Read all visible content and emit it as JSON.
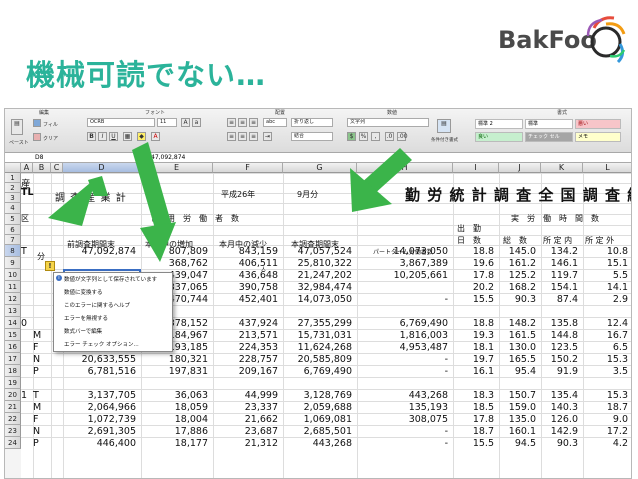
{
  "slide": {
    "title": "機械可読でない…"
  },
  "logo": {
    "text": "BakFoo"
  },
  "ribbon": {
    "groups": [
      "編集",
      "フォント",
      "配置",
      "数値",
      "書式"
    ],
    "fill_label": "フィル",
    "clear_label": "クリア",
    "paste_label": "ペースト",
    "font_name": "OCRB",
    "font_size": "11",
    "wrap_label": "折り返し",
    "abc_label": "abc",
    "merge_label": "結合",
    "number_format": "文字列",
    "cond_format": "条件付き書式",
    "styles": [
      "標準 2",
      "標準",
      "悪い",
      "良い",
      "チェック セル",
      "メモ"
    ]
  },
  "formula_bar": {
    "cell_ref": "D8",
    "value": "47,092,874"
  },
  "columns": [
    "A",
    "B",
    "C",
    "D",
    "E",
    "F",
    "G",
    "H",
    "I",
    "J",
    "K",
    "L"
  ],
  "rows": [
    "1",
    "2",
    "3",
    "4",
    "5",
    "6",
    "7",
    "8",
    "9",
    "10",
    "11",
    "12",
    "13",
    "14",
    "15",
    "16",
    "17",
    "18",
    "19",
    "20",
    "21",
    "22",
    "23",
    "24"
  ],
  "header": {
    "r1_a": "産",
    "r2_a": "TL",
    "r2_c": "調 査 産 業 計",
    "r2_f": "平成26年",
    "r2_g": "9月分",
    "title_big": "勤 労 統 計 調 査 全 国 調 査 結",
    "r4_a": "区",
    "kubun_top": "常　用　労　働　者　数",
    "col_d": "前調査期間末",
    "col_e": "本月中の増加",
    "col_f": "本月中の減少",
    "col_g": "本調査期間末",
    "col_h": "パートタイム労働者数",
    "shukkin": "出　勤",
    "nissu": "日　数",
    "jitsu": "実　労　働　時　間　数",
    "soukei": "総　数",
    "shoteinai": "所 定 内",
    "shoteigai": "所 定 外",
    "r6_a": "分",
    "unit_a": "人"
  },
  "error_menu": {
    "items": [
      "数値が文字列として保存されています",
      "数値に変換する",
      "このエラーに関するヘルプ",
      "エラーを無視する",
      "数式バーで編集",
      "エラー チェック オプション..."
    ]
  },
  "table": [
    {
      "r": "8",
      "a": "T",
      "b": "",
      "d": "47,092,874",
      "e": "807,809",
      "f": "843,159",
      "g": "47,057,524",
      "h": "14,073,050",
      "i": "18.8",
      "j": "145.0",
      "k": "134.2",
      "l": "10.8"
    },
    {
      "r": "9",
      "a": "",
      "b": "",
      "d": "",
      "e": "368,762",
      "f": "406,511",
      "g": "25,810,322",
      "h": "3,867,389",
      "i": "19.6",
      "j": "161.2",
      "k": "146.1",
      "l": "15.1"
    },
    {
      "r": "10",
      "a": "",
      "b": "",
      "d": "",
      "e": "439,047",
      "f": "436,648",
      "g": "21,247,202",
      "h": "10,205,661",
      "i": "17.8",
      "j": "125.2",
      "k": "119.7",
      "l": "5.5"
    },
    {
      "r": "11",
      "a": "",
      "b": "",
      "d": "",
      "e": "337,065",
      "f": "390,758",
      "g": "32,984,474",
      "h": "",
      "i": "20.2",
      "j": "168.2",
      "k": "154.1",
      "l": "14.1"
    },
    {
      "r": "12",
      "a": "",
      "b": "",
      "d": "",
      "e": "470,744",
      "f": "452,401",
      "g": "14,073,050",
      "h": "-",
      "i": "15.5",
      "j": "90.3",
      "k": "87.4",
      "l": "2.9"
    },
    {
      "r": "13",
      "a": "",
      "b": "",
      "d": "",
      "e": "",
      "f": "",
      "g": "",
      "h": "",
      "i": "",
      "j": "",
      "k": "",
      "l": ""
    },
    {
      "r": "14",
      "a": "0",
      "b": "",
      "d": "",
      "e": "378,152",
      "f": "437,924",
      "g": "27,355,299",
      "h": "6,769,490",
      "i": "18.8",
      "j": "148.2",
      "k": "135.8",
      "l": "12.4"
    },
    {
      "r": "15",
      "a": "",
      "b": "M",
      "d": "",
      "e": "184,967",
      "f": "213,571",
      "g": "15,731,031",
      "h": "1,816,003",
      "i": "19.3",
      "j": "161.5",
      "k": "144.8",
      "l": "16.7"
    },
    {
      "r": "16",
      "a": "",
      "b": "F",
      "d": "11,655,436",
      "e": "193,185",
      "f": "224,353",
      "g": "11,624,268",
      "h": "4,953,487",
      "i": "18.1",
      "j": "130.0",
      "k": "123.5",
      "l": "6.5"
    },
    {
      "r": "17",
      "a": "",
      "b": "N",
      "d": "20,633,555",
      "e": "180,321",
      "f": "228,757",
      "g": "20,585,809",
      "h": "-",
      "i": "19.7",
      "j": "165.5",
      "k": "150.2",
      "l": "15.3"
    },
    {
      "r": "18",
      "a": "",
      "b": "P",
      "d": "6,781,516",
      "e": "197,831",
      "f": "209,167",
      "g": "6,769,490",
      "h": "-",
      "i": "16.1",
      "j": "95.4",
      "k": "91.9",
      "l": "3.5"
    },
    {
      "r": "19",
      "a": "",
      "b": "",
      "d": "",
      "e": "",
      "f": "",
      "g": "",
      "h": "",
      "i": "",
      "j": "",
      "k": "",
      "l": ""
    },
    {
      "r": "20",
      "a": "1",
      "b": "T",
      "d": "3,137,705",
      "e": "36,063",
      "f": "44,999",
      "g": "3,128,769",
      "h": "443,268",
      "i": "18.3",
      "j": "150.7",
      "k": "135.4",
      "l": "15.3"
    },
    {
      "r": "21",
      "a": "",
      "b": "M",
      "d": "2,064,966",
      "e": "18,059",
      "f": "23,337",
      "g": "2,059,688",
      "h": "135,193",
      "i": "18.5",
      "j": "159.0",
      "k": "140.3",
      "l": "18.7"
    },
    {
      "r": "22",
      "a": "",
      "b": "F",
      "d": "1,072,739",
      "e": "18,004",
      "f": "21,662",
      "g": "1,069,081",
      "h": "308,075",
      "i": "17.8",
      "j": "135.0",
      "k": "126.0",
      "l": "9.0"
    },
    {
      "r": "23",
      "a": "",
      "b": "N",
      "d": "2,691,305",
      "e": "17,886",
      "f": "23,687",
      "g": "2,685,501",
      "h": "-",
      "i": "18.7",
      "j": "160.1",
      "k": "142.9",
      "l": "17.2"
    },
    {
      "r": "24",
      "a": "",
      "b": "P",
      "d": "446,400",
      "e": "18,177",
      "f": "21,312",
      "g": "443,268",
      "h": "-",
      "i": "15.5",
      "j": "94.5",
      "k": "90.3",
      "l": "4.2"
    }
  ],
  "colors": {
    "title": "#2bb39a",
    "arrow": "#3bb44a",
    "warn": "#f5d44a"
  }
}
